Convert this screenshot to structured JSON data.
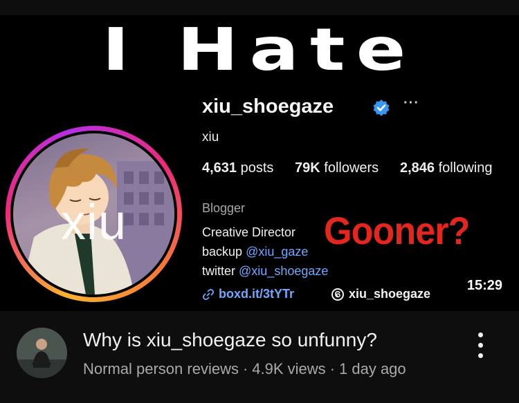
{
  "thumbnail": {
    "overlay_title": "I Hate",
    "overlay_question": "Gooner?",
    "duration": "15:29",
    "profile": {
      "username": "xiu_shoegaze",
      "verified_icon": "verified-badge-icon",
      "more_icon": "···",
      "display_name": "xiu",
      "avatar_watermark": "xiu",
      "stats": {
        "posts_count": "4,631",
        "posts_label": "posts",
        "followers_count": "79K",
        "followers_label": "followers",
        "following_count": "2,846",
        "following_label": "following"
      },
      "category": "Blogger",
      "bio": {
        "line1": "Creative Director",
        "line2_prefix": "backup",
        "line2_handle": "@xiu_gaze",
        "line3_prefix": "twitter",
        "line3_handle": "@xiu_shoegaze"
      },
      "link_icon": "🔗",
      "link_text": "boxd.it/3tYTr",
      "threads_handle": "xiu_shoegaze"
    },
    "colors": {
      "link_blue": "#6ea8ff",
      "overlay_red": "#e4261f",
      "verified_blue": "#3897f0"
    }
  },
  "video": {
    "title": "Why is xiu_shoegaze so unfunny?",
    "channel": "Normal person reviews",
    "views": "4.9K views",
    "age": "1 day ago",
    "separator": "·"
  }
}
